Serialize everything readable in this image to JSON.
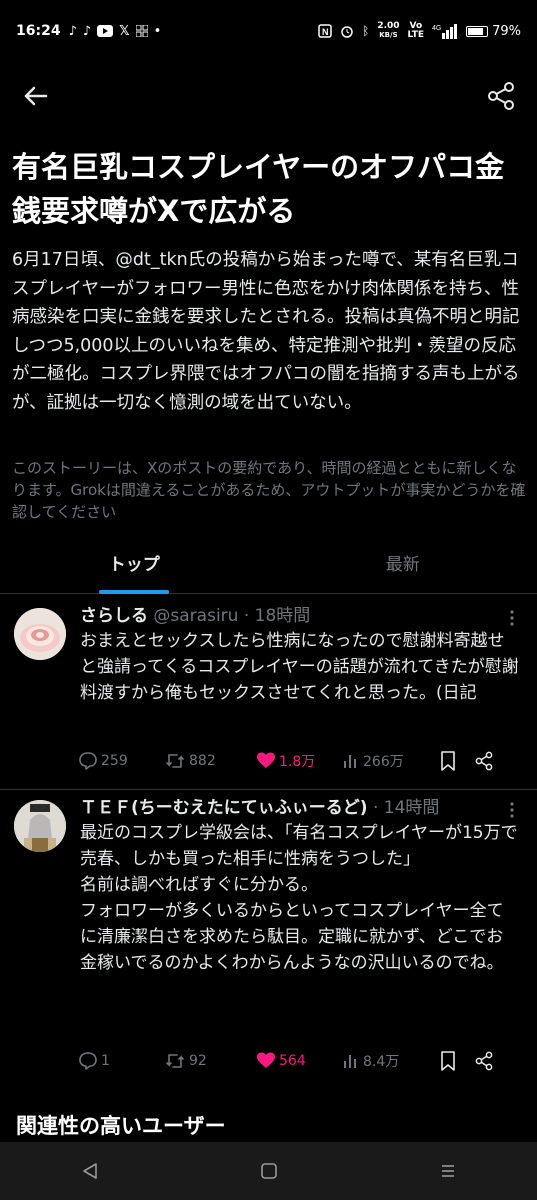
{
  "status_bar": {
    "time": "16:24",
    "speed_value": "2.00",
    "speed_unit": "KB/S",
    "battery": "79%",
    "icons": [
      "tiktok-icon",
      "tiktok-icon",
      "youtube-icon",
      "x-icon",
      "grid-icon",
      "dot",
      "nfc-icon",
      "alarm-icon",
      "bluetooth-icon",
      "volte-icon",
      "signal-icon",
      "battery-icon"
    ]
  },
  "nav": {
    "back_icon": "arrow-left-icon",
    "share_icon": "share-icon"
  },
  "headline": "有名巨乳コスプレイヤーのオフパコ金銭要求噂がXで広がる",
  "summary": "6月17日頃、@dt_tkn氏の投稿から始まった噂で、某有名巨乳コスプレイヤーがフォロワー男性に色恋をかけ肉体関係を持ち、性病感染を口実に金銭を要求したとされる。投稿は真偽不明と明記しつつ5,000以上のいいねを集め、特定推測や批判・羨望の反応が二極化。コスプレ界隈ではオフパコの闇を指摘する声も上がるが、証拠は一切なく憶測の域を出ていない。",
  "disclaimer": "このストーリーは、Xのポストの要約であり、時間の経過とともに新しくなります。Grokは間違えることがあるため、アウトプットが事実かどうかを確認してください",
  "tabs": [
    {
      "label": "トップ",
      "active": true
    },
    {
      "label": "最新",
      "active": false
    }
  ],
  "posts": [
    {
      "name": "さらしる",
      "handle": "@sarasiru",
      "time": "· 18時間",
      "text": "おまえとセックスしたら性病になったので慰謝料寄越せと強請ってくるコスプレイヤーの話題が流れてきたが慰謝料渡すから俺もセックスさせてくれと思った。(日記",
      "replies": "259",
      "reposts": "882",
      "likes": "1.8万",
      "views": "266万"
    },
    {
      "name": "ＴＥＦ(ちーむえたにてぃふぃーるど)",
      "handle": "",
      "time": "· 14時間",
      "text": "最近のコスプレ学級会は、「有名コスプレイヤーが15万で売春、しかも買った相手に性病をうつした」\n名前は調べればすぐに分かる。\nフォロワーが多くいるからといってコスプレイヤー全てに清廉潔白さを求めたら駄目。定職に就かず、どこでお金稼いでるのかよくわからんようなの沢山いるのでね。",
      "replies": "1",
      "reposts": "92",
      "likes": "564",
      "views": "8.4万"
    }
  ],
  "related_title": "関連性の高いユーザー",
  "colors": {
    "accent": "#1d9bf0",
    "like": "#f91880",
    "muted": "#71767b"
  }
}
